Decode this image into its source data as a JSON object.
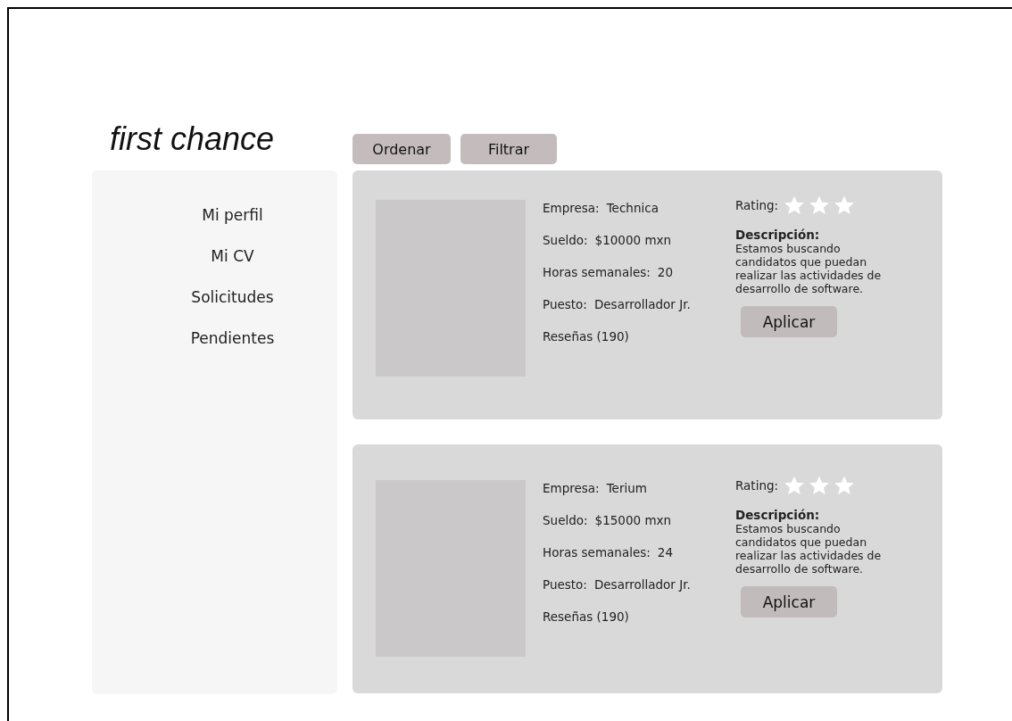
{
  "logo": "first chance",
  "toolbar": [
    "Ordenar",
    "Filtrar"
  ],
  "sidebar": {
    "items": [
      "Mi perfil",
      "Mi CV",
      "Solicitudes",
      "Pendientes"
    ]
  },
  "jobs": [
    {
      "fields": [
        {
          "label": "Empresa:",
          "value": "Technica"
        },
        {
          "label": "Sueldo:",
          "value": "$10000 mxn"
        },
        {
          "label": "Horas semanales:",
          "value": "20"
        },
        {
          "label": "Puesto:",
          "value": "Desarrollador Jr."
        }
      ],
      "reviews": "Reseñas (190)",
      "rating_label": "Rating:",
      "stars": 0,
      "description_label": "Descripción:",
      "description": "Estamos buscando candidatos que puedan realizar las actividades de desarrollo de software.",
      "apply": "Aplicar"
    },
    {
      "fields": [
        {
          "label": "Empresa:",
          "value": "Terium"
        },
        {
          "label": "Sueldo:",
          "value": "$15000 mxn"
        },
        {
          "label": "Horas semanales:",
          "value": "24"
        },
        {
          "label": "Puesto:",
          "value": "Desarrollador Jr."
        }
      ],
      "reviews": "Reseñas (190)",
      "rating_label": "Rating:",
      "stars": 0,
      "description_label": "Descripción:",
      "description": "Estamos buscando candidatos que puedan realizar las actividades de desarrollo de software.",
      "apply": "Aplicar"
    }
  ]
}
